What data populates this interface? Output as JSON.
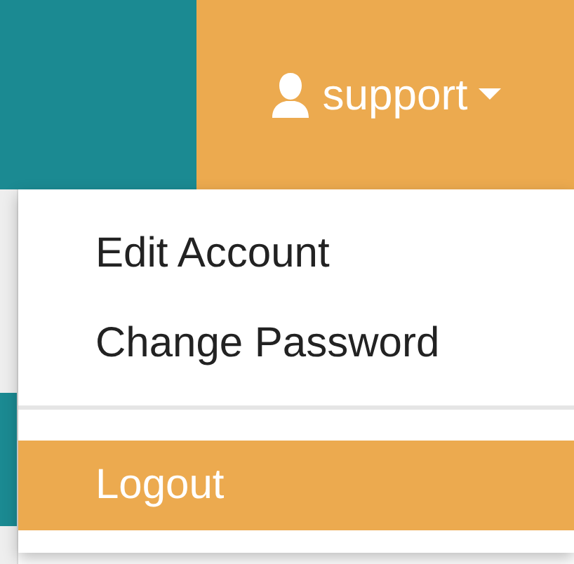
{
  "user_menu": {
    "username": "support",
    "expanded": true
  },
  "dropdown": {
    "items": [
      {
        "label": "Edit Account",
        "selected": false
      },
      {
        "label": "Change Password",
        "selected": false
      },
      {
        "kind": "divider"
      },
      {
        "label": "Logout",
        "selected": true
      }
    ]
  }
}
